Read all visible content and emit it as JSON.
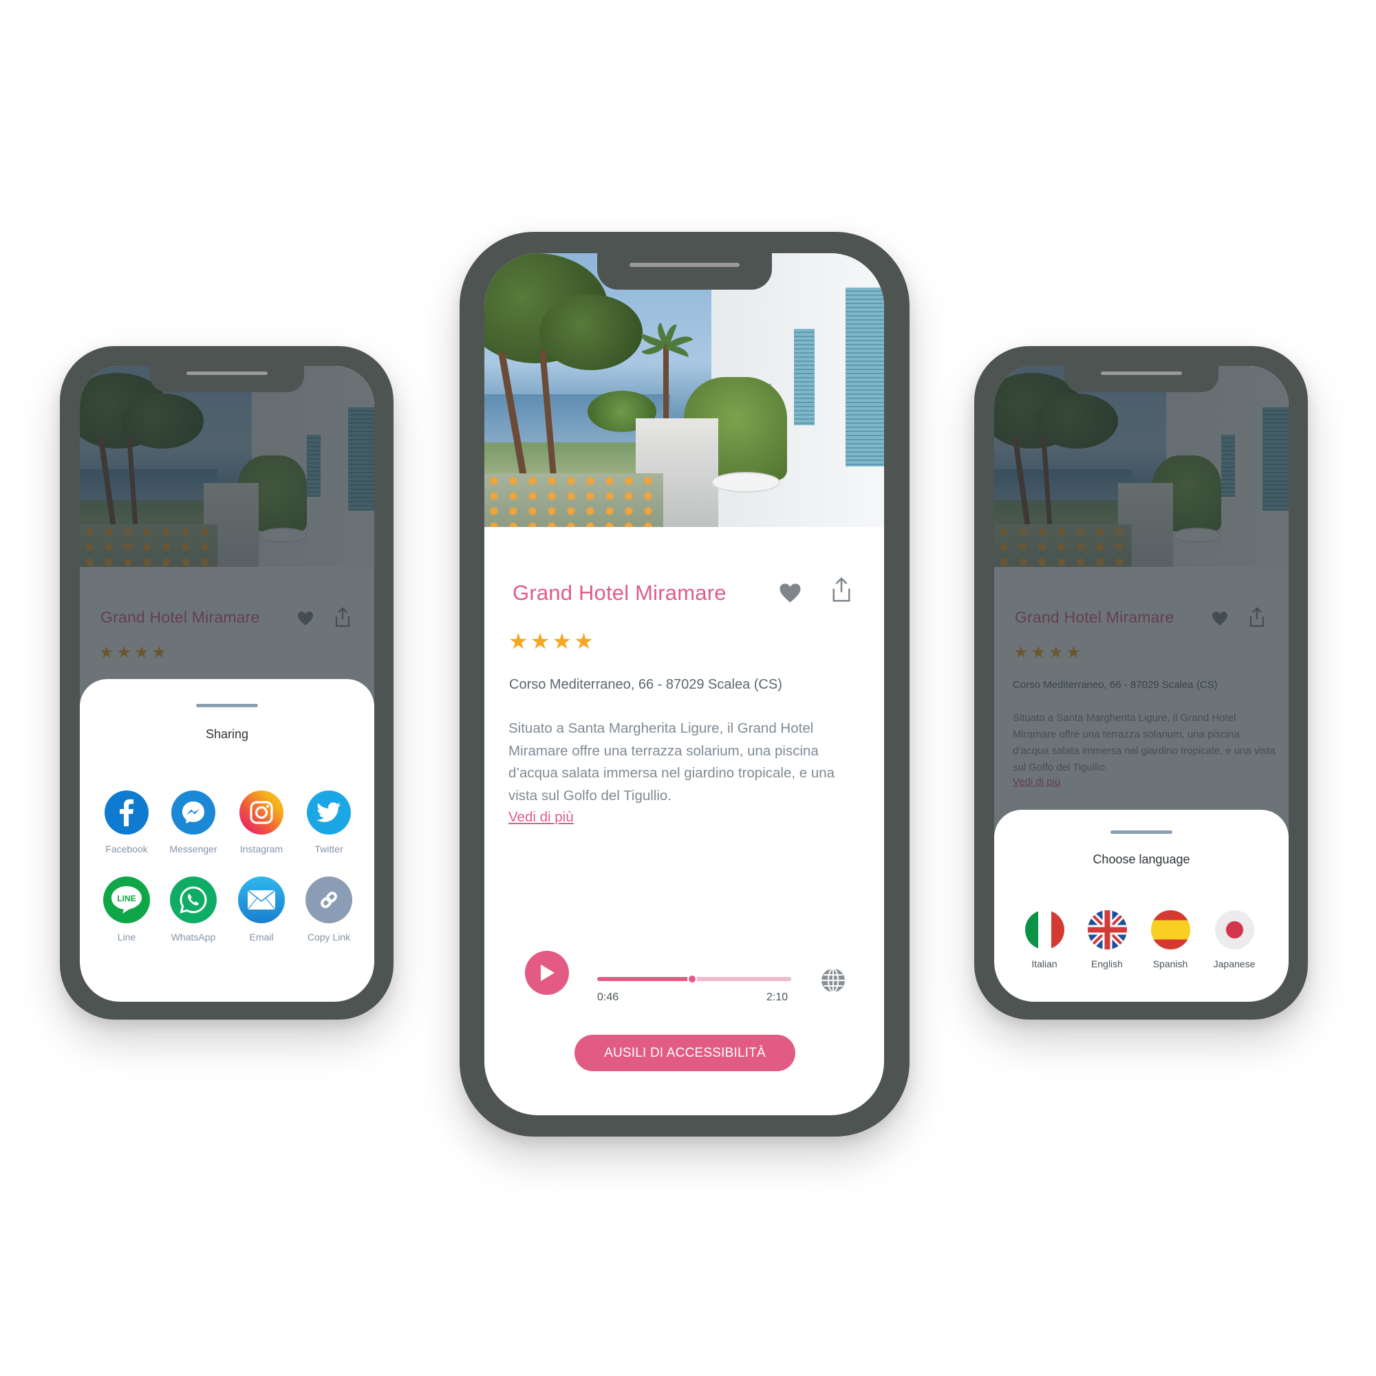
{
  "hotel": {
    "name": "Grand Hotel Miramare",
    "rating": 4,
    "rating_max": 4,
    "star_glyph": "★",
    "address": "Corso Mediterraneo, 66 - 87029 Scalea (CS)",
    "description": "Situato a Santa Margherita Ligure, il Grand Hotel Miramare offre una terrazza solarium, una piscina d’acqua salata immersa nel giardino tropicale, e una vista sul Golfo del Tigullio.",
    "more_link": "Vedi di più",
    "favorite_icon": "heart-icon",
    "share_icon": "share-icon"
  },
  "player": {
    "current_time": "0:46",
    "total_time": "2:10",
    "progress": 0.49,
    "play_icon": "play-icon",
    "language_icon": "globe-icon"
  },
  "cta": {
    "label": "AUSILI DI ACCESSIBILITÀ"
  },
  "sharing_sheet": {
    "title": "Sharing",
    "items": [
      {
        "label": "Facebook",
        "icon": "facebook-icon",
        "color": "#0f7bd0"
      },
      {
        "label": "Messenger",
        "icon": "messenger-icon",
        "color": "#1b88d6"
      },
      {
        "label": "Instagram",
        "icon": "instagram-icon",
        "color": "#f0a21e"
      },
      {
        "label": "Twitter",
        "icon": "twitter-icon",
        "color": "#1ba6e6"
      },
      {
        "label": "Line",
        "icon": "line-icon",
        "color": "#0ea646"
      },
      {
        "label": "WhatsApp",
        "icon": "whatsapp-icon",
        "color": "#10ac66"
      },
      {
        "label": "Email",
        "icon": "email-icon",
        "color": "#1f95de"
      },
      {
        "label": "Copy Link",
        "icon": "link-icon",
        "color": "#8b9db5"
      }
    ]
  },
  "language_sheet": {
    "title": "Choose language",
    "items": [
      {
        "label": "Italian",
        "icon": "italy-flag-icon"
      },
      {
        "label": "English",
        "icon": "uk-flag-icon"
      },
      {
        "label": "Spanish",
        "icon": "spain-flag-icon"
      },
      {
        "label": "Japanese",
        "icon": "japan-flag-icon"
      }
    ]
  },
  "colors": {
    "accent": "#e35b85",
    "star": "#f5a623",
    "frame": "#4e5451",
    "text_muted": "#808a93"
  }
}
